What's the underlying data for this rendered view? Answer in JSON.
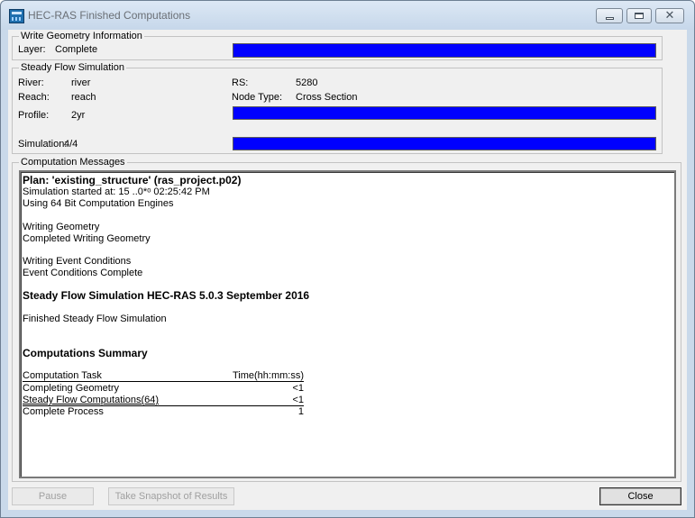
{
  "window": {
    "title": "HEC-RAS Finished Computations"
  },
  "write_geometry": {
    "legend": "Write Geometry Information",
    "layer_label": "Layer:",
    "layer_value": "Complete",
    "progress": 1.0
  },
  "steady_flow": {
    "legend": "Steady Flow Simulation",
    "river_label": "River:",
    "river_value": "river",
    "reach_label": "Reach:",
    "reach_value": "reach",
    "profile_label": "Profile:",
    "profile_value": "2yr",
    "rs_label": "RS:",
    "rs_value": "5280",
    "node_type_label": "Node Type:",
    "node_type_value": "Cross Section",
    "profile_progress": 1.0,
    "simulation_label": "Simulation:",
    "simulation_value": "4/4",
    "simulation_progress": 1.0
  },
  "messages": {
    "legend": "Computation Messages",
    "plan_line": "Plan: 'existing_structure' (ras_project.p02)",
    "started_line": "Simulation started at: 15 ..0*ᵒ 02:25:42 PM",
    "engine_line": "Using 64 Bit Computation Engines",
    "writing_geometry": "Writing Geometry",
    "completed_geometry": "Completed Writing Geometry",
    "writing_event": "Writing Event Conditions",
    "event_complete": "Event Conditions Complete",
    "version_line": "Steady Flow Simulation HEC-RAS 5.0.3 September 2016",
    "finished_line": "Finished Steady Flow Simulation",
    "summary_title": "Computations Summary",
    "summary_header": {
      "task": "Computation Task",
      "time": "Time(hh:mm:ss)"
    },
    "summary_rows": [
      {
        "task": "Completing Geometry",
        "time": "<1"
      },
      {
        "task": "Steady Flow Computations(64)",
        "time": "<1"
      },
      {
        "task": "Complete Process",
        "time": "1"
      }
    ]
  },
  "buttons": {
    "pause": "Pause",
    "snapshot": "Take Snapshot of Results",
    "close": "Close"
  },
  "colors": {
    "progress_fill": "#0000ff",
    "title_text": "#6a6f75"
  }
}
